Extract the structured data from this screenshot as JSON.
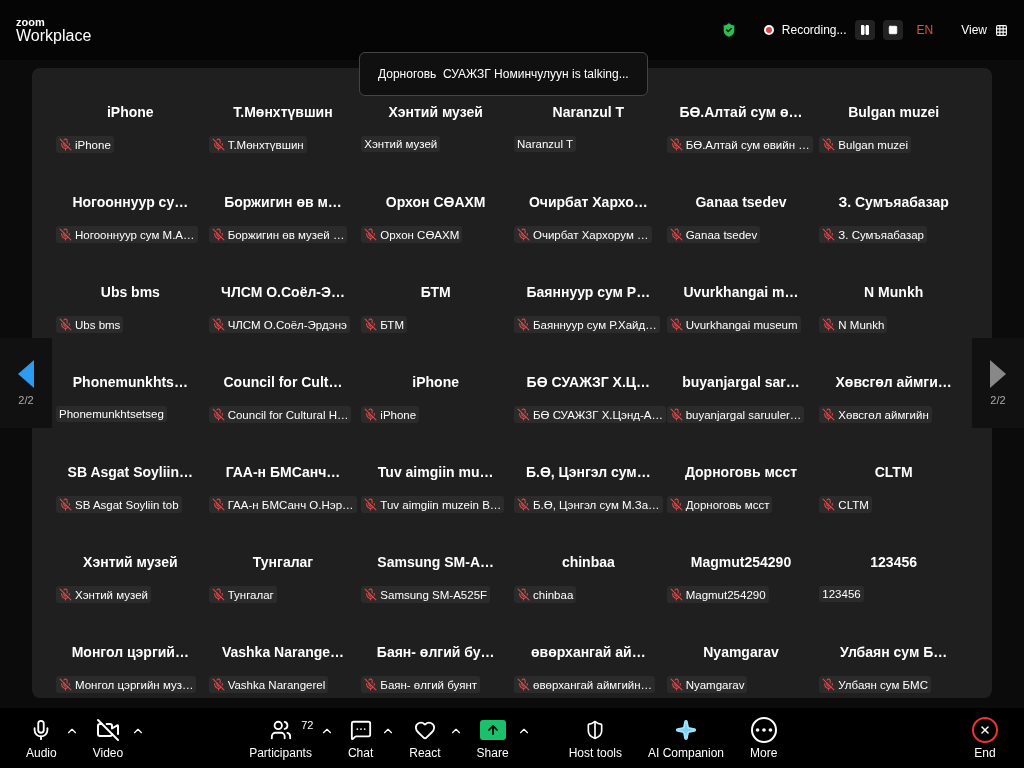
{
  "brand": {
    "top": "zoom",
    "bottom": "Workplace"
  },
  "header": {
    "recording": "Recording...",
    "language": "EN",
    "view": "View"
  },
  "toast": "Дорноговь  СУАЖЗГ Номинчулуун is talking...",
  "pager": {
    "left": "2/2",
    "right": "2/2"
  },
  "tiles": [
    {
      "name": "iPhone",
      "label": "iPhone",
      "muted": true
    },
    {
      "name": "Т.Мөнхтүвшин",
      "label": "Т.Мөнхтүвшин",
      "muted": true
    },
    {
      "name": "Хэнтий музей",
      "label": "Хэнтий музей",
      "muted": false
    },
    {
      "name": "Naranzul T",
      "label": "Naranzul T",
      "muted": false
    },
    {
      "name": "БӨ.Алтай сум ө…",
      "label": "БӨ.Алтай сум өвийн …",
      "muted": true
    },
    {
      "name": "Bulgan muzei",
      "label": "Bulgan muzei",
      "muted": true
    },
    {
      "name": "Ногооннуур су…",
      "label": "Ногооннуур сум М.А…",
      "muted": true
    },
    {
      "name": "Боржигин өв м…",
      "label": "Боржигин өв музей …",
      "muted": true
    },
    {
      "name": "Орхон СӨАХМ",
      "label": "Орхон СӨАХМ",
      "muted": true
    },
    {
      "name": "Очирбат Хархо…",
      "label": "Очирбат Хархорум …",
      "muted": true
    },
    {
      "name": "Ganaa tsedev",
      "label": "Ganaa tsedev",
      "muted": true
    },
    {
      "name": "З. Сумъяабазар",
      "label": "З. Сумъяабазар",
      "muted": true
    },
    {
      "name": "Ubs bms",
      "label": "Ubs bms",
      "muted": true
    },
    {
      "name": "ЧЛСМ О.Соёл-Э…",
      "label": "ЧЛСМ О.Соёл-Эрдэнэ",
      "muted": true
    },
    {
      "name": "БТМ",
      "label": "БТМ",
      "muted": true
    },
    {
      "name": "Баяннуур сум Р…",
      "label": "Баяннуур сум Р.Хайд…",
      "muted": true
    },
    {
      "name": "Uvurkhangai m…",
      "label": "Uvurkhangai museum",
      "muted": true
    },
    {
      "name": "N Munkh",
      "label": "N Munkh",
      "muted": true
    },
    {
      "name": "Phonemunkhts…",
      "label": "Phonemunkhtsetseg",
      "muted": false
    },
    {
      "name": "Council for Cult…",
      "label": "Council for Cultural H…",
      "muted": true
    },
    {
      "name": "iPhone",
      "label": "iPhone",
      "muted": true
    },
    {
      "name": "БӨ СУАЖЗГ Х.Ц…",
      "label": "БӨ СУАЖЗГ Х.Цэнд-А…",
      "muted": true
    },
    {
      "name": "buyanjargal sar…",
      "label": "buyanjargal saruuler…",
      "muted": true
    },
    {
      "name": "Хөвсгөл аймги…",
      "label": "Хөвсгөл аймгийн",
      "muted": true
    },
    {
      "name": "SB Asgat Soyliin…",
      "label": "SB Asgat Soyliin tob",
      "muted": true
    },
    {
      "name": "ГАА-н БМСанч…",
      "label": "ГАА-н БМСанч О.Нэр…",
      "muted": true
    },
    {
      "name": "Tuv aimgiin mu…",
      "label": "Tuv aimgiin muzein B…",
      "muted": true
    },
    {
      "name": "Б.Ө, Цэнгэл сум…",
      "label": "Б.Ө, Цэнгэл сум М.За…",
      "muted": true
    },
    {
      "name": "Дорноговь мсст",
      "label": "Дорноговь мсст",
      "muted": true
    },
    {
      "name": "CLTM",
      "label": "CLTM",
      "muted": true
    },
    {
      "name": "Хэнтий музей",
      "label": "Хэнтий музей",
      "muted": true
    },
    {
      "name": "Тунгалаг",
      "label": "Тунгалаг",
      "muted": true
    },
    {
      "name": "Samsung SM-A…",
      "label": "Samsung SM-A525F",
      "muted": true
    },
    {
      "name": "chinbaa",
      "label": "chinbaa",
      "muted": true
    },
    {
      "name": "Magmut254290",
      "label": "Magmut254290",
      "muted": true
    },
    {
      "name": "123456",
      "label": "123456",
      "muted": false
    },
    {
      "name": "Монгол цэргий…",
      "label": "Монгол цэргийн муз…",
      "muted": true
    },
    {
      "name": "Vashka Narange…",
      "label": "Vashka Narangerel",
      "muted": true
    },
    {
      "name": "Баян- өлгий бу…",
      "label": "Баян- өлгий буянт",
      "muted": true
    },
    {
      "name": "өвөрхангай ай…",
      "label": "өвөрхангай аймгийн…",
      "muted": true
    },
    {
      "name": "Nyamgarav",
      "label": "Nyamgarav",
      "muted": true
    },
    {
      "name": "Улбаян сум Б…",
      "label": "Улбаян сум БМС",
      "muted": true
    }
  ],
  "toolbar": [
    {
      "kind": "audio",
      "label": "Audio",
      "caret": true
    },
    {
      "kind": "video",
      "label": "Video",
      "caret": true
    },
    {
      "kind": "participants",
      "label": "Participants",
      "count": "72",
      "caret": true
    },
    {
      "kind": "chat",
      "label": "Chat",
      "caret": true
    },
    {
      "kind": "react",
      "label": "React",
      "caret": true
    },
    {
      "kind": "share",
      "label": "Share",
      "caret": true
    },
    {
      "kind": "host",
      "label": "Host tools",
      "caret": false
    },
    {
      "kind": "ai",
      "label": "AI Companion",
      "caret": false
    },
    {
      "kind": "more",
      "label": "More",
      "caret": false
    },
    {
      "kind": "end",
      "label": "End",
      "caret": false
    }
  ]
}
